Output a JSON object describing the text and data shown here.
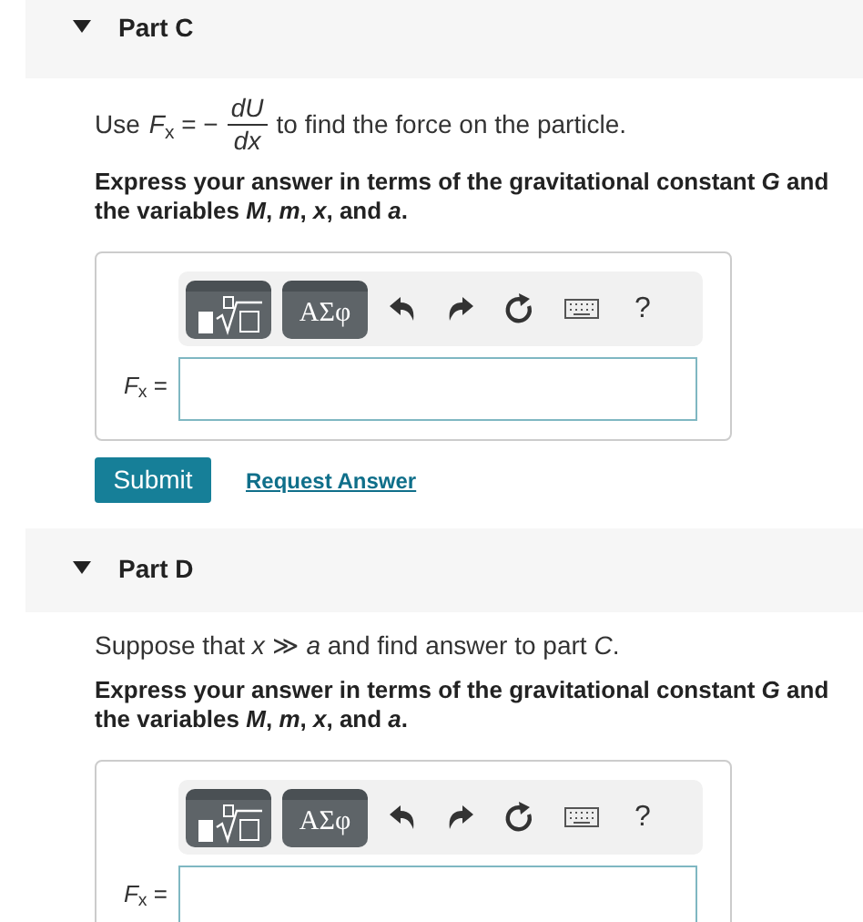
{
  "parts": [
    {
      "title": "Part C",
      "expanded": true,
      "intro": {
        "kind": "fraction",
        "prefix": "Use",
        "lhs": "*F*$_{x}$ = −",
        "numerator": "*dU*",
        "denominator": "*dx*",
        "suffix": "to find the force on the particle."
      },
      "instruction": "Express your answer in terms of the gravitational constant *G* and the variables *M*, *m*, *x*, and *a*.",
      "toolbar": [
        {
          "kind": "templates"
        },
        {
          "kind": "symbols",
          "label": "ΑΣφ"
        },
        {
          "kind": "undo"
        },
        {
          "kind": "redo"
        },
        {
          "kind": "reset"
        },
        {
          "kind": "keyboard"
        },
        {
          "kind": "help",
          "label": "?"
        }
      ],
      "answer_label": "*F*$_{x}$ =",
      "actions": {
        "submit": "Submit",
        "request": "Request Answer"
      }
    },
    {
      "title": "Part D",
      "expanded": true,
      "intro": {
        "kind": "plain",
        "text": "Suppose that *x* ≫ *a* and find answer to part *C*."
      },
      "instruction": "Express your answer in terms of the gravitational constant *G* and the variables *M*, *m*, *x*, and *a*.",
      "toolbar": [
        {
          "kind": "templates"
        },
        {
          "kind": "symbols",
          "label": "ΑΣφ"
        },
        {
          "kind": "undo"
        },
        {
          "kind": "redo"
        },
        {
          "kind": "reset"
        },
        {
          "kind": "keyboard"
        },
        {
          "kind": "help",
          "label": "?"
        }
      ],
      "answer_label": "*F*$_{x}$ ="
    }
  ]
}
